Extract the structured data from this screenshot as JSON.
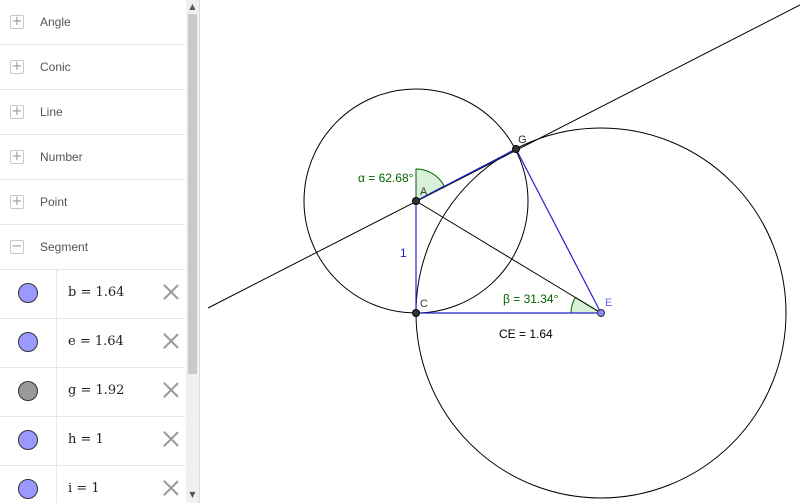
{
  "algebra": {
    "categories": [
      {
        "label": "Angle",
        "toggle": "+"
      },
      {
        "label": "Conic",
        "toggle": "+"
      },
      {
        "label": "Line",
        "toggle": "+"
      },
      {
        "label": "Number",
        "toggle": "+"
      },
      {
        "label": "Point",
        "toggle": "+"
      },
      {
        "label": "Segment",
        "toggle": "−"
      }
    ],
    "segments": [
      {
        "text": "b = 1.64",
        "color": "#9999ff"
      },
      {
        "text": "e = 1.64",
        "color": "#9999ff"
      },
      {
        "text": "g = 1.92",
        "color": "#999999"
      },
      {
        "text": "h = 1",
        "color": "#9999ff"
      },
      {
        "text": "i = 1",
        "color": "#9999ff"
      }
    ],
    "scroll_up": "▲",
    "scroll_down": "▼"
  },
  "graphics": {
    "points": {
      "A": "A",
      "C": "C",
      "E": "E",
      "G": "G"
    },
    "angle_alpha": "α = 62.68°",
    "angle_beta": "β = 31.34°",
    "segment_label_1": "1",
    "segment_CE": "CE = 1.64"
  },
  "colors": {
    "segment_blue": "#2222cc",
    "angle_green": "#006400",
    "angle_fill": "#d8f0d8"
  }
}
